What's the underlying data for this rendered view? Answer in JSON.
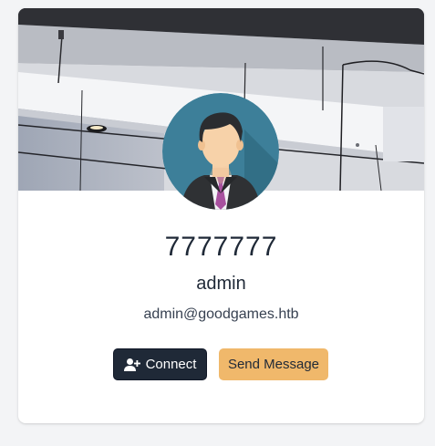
{
  "profile": {
    "name": "7777777",
    "role": "admin",
    "email": "admin@goodgames.htb"
  },
  "actions": {
    "connect_label": "Connect",
    "send_message_label": "Send Message"
  },
  "icons": {
    "connect": "user-plus-icon",
    "avatar": "user-avatar-icon"
  },
  "colors": {
    "page_background": "#f3f4f6",
    "card_background": "#ffffff",
    "connect_button": "#1f2937",
    "send_message_button": "#f0b86b",
    "avatar_background": "#3d7f99"
  }
}
